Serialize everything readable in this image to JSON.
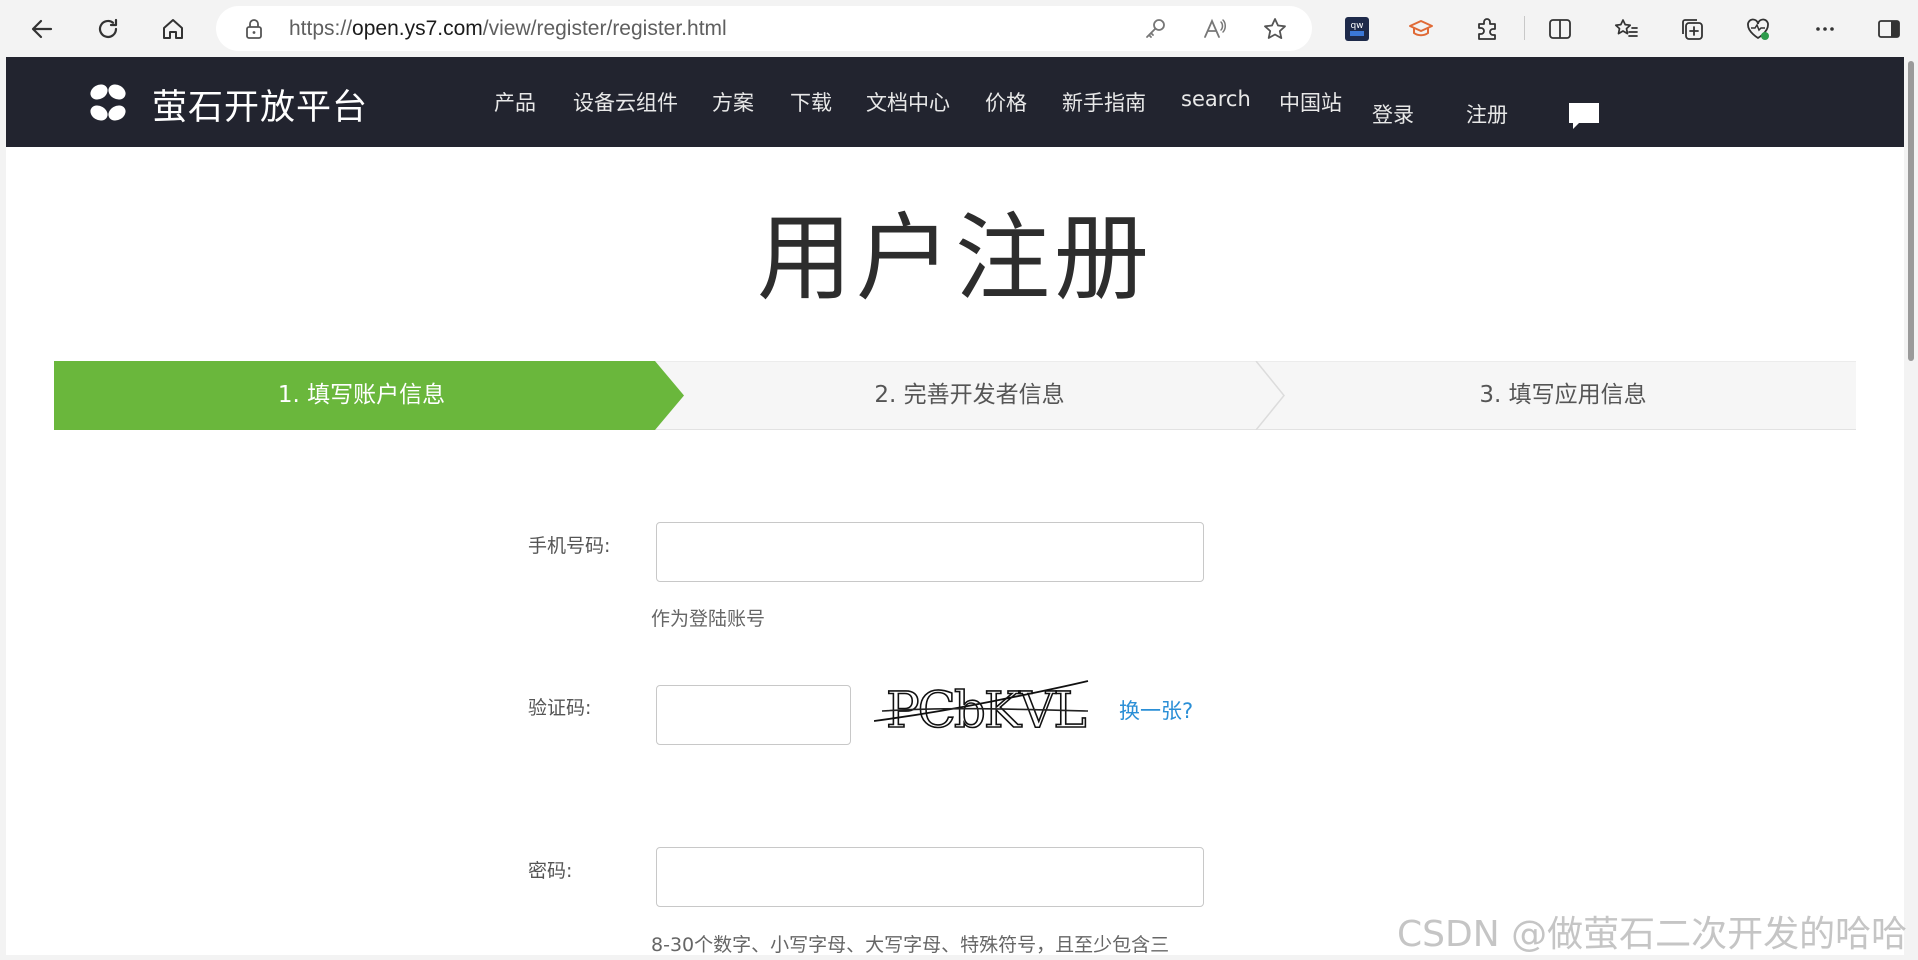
{
  "browser": {
    "url_prefix": "https://",
    "url_host": "open.ys7.com",
    "url_path": "/view/register/register.html"
  },
  "site": {
    "logo_text": "萤石开放平台",
    "nav": [
      "产品",
      "设备云组件",
      "方案",
      "下载",
      "文档中心",
      "价格",
      "新手指南",
      "search",
      "中国站"
    ],
    "login": "登录",
    "register": "注册"
  },
  "page": {
    "title": "用户注册"
  },
  "steps": [
    {
      "label": "1. 填写账户信息",
      "active": true
    },
    {
      "label": "2. 完善开发者信息",
      "active": false
    },
    {
      "label": "3. 填写应用信息",
      "active": false
    }
  ],
  "form": {
    "phone_label": "手机号码:",
    "phone_value": "",
    "phone_hint": "作为登陆账号",
    "captcha_label": "验证码:",
    "captcha_value": "",
    "captcha_image_text": "PCbKVL",
    "captcha_refresh": "换一张?",
    "password_label": "密码:",
    "password_value": "",
    "password_hint": "8-30个数字、小写字母、大写字母、特殊符号，且至少包含三"
  },
  "colors": {
    "header_bg": "#22242f",
    "step_active": "#6ab73c",
    "link": "#2b8fd6"
  },
  "watermark": "CSDN @做萤石二次开发的哈哈"
}
